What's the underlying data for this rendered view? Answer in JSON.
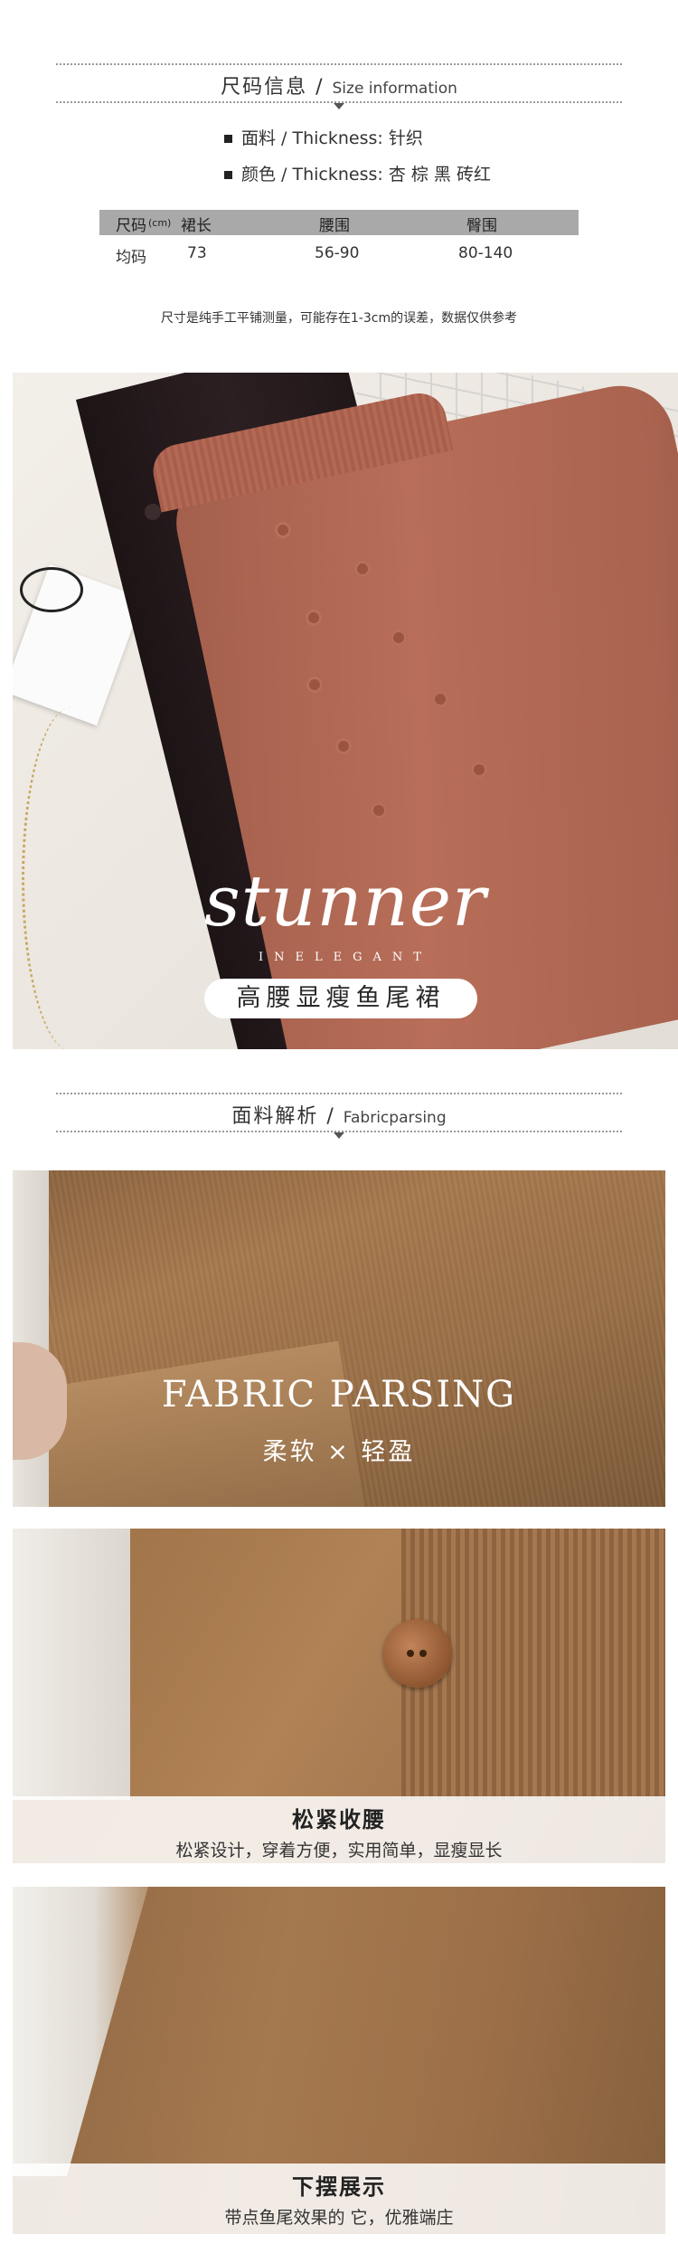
{
  "size_section": {
    "heading_cn": "尺码信息",
    "heading_sep": "/",
    "heading_en": "Size information",
    "info_lines": [
      "面料 / Thickness: 针织",
      "颜色 / Thickness: 杏 棕 黑 砖红"
    ],
    "table": {
      "headers": [
        "尺码",
        "(cm)",
        "裙长",
        "腰围",
        "臀围"
      ],
      "rows": [
        {
          "size": "均码",
          "length": "73",
          "waist": "56-90",
          "hip": "80-140"
        }
      ]
    },
    "note": "尺寸是纯手工平铺测量，可能存在1-3cm的误差，数据仅供参考"
  },
  "banner": {
    "script_title": "stunner",
    "subtitle": "INELEGANT",
    "pill_text": "高腰显瘦鱼尾裙"
  },
  "fabric_section": {
    "heading_cn": "面料解析",
    "heading_sep": "/",
    "heading_en": "Fabricparsing",
    "panel1": {
      "title": "FABRIC PARSING",
      "subtitle": "柔软 × 轻盈"
    },
    "panel2": {
      "title": "松紧收腰",
      "subtitle": "松紧设计，穿着方便，实用简单，显瘦显长"
    },
    "panel3": {
      "title": "下摆展示",
      "subtitle": "带点鱼尾效果的 它，优雅端庄"
    }
  },
  "colors": {
    "table_header_bg": "#a9a9a9",
    "rust_skirt": "#b86e59",
    "dark_skirt": "#2c1f22",
    "camel_fabric": "#a77a4f"
  }
}
